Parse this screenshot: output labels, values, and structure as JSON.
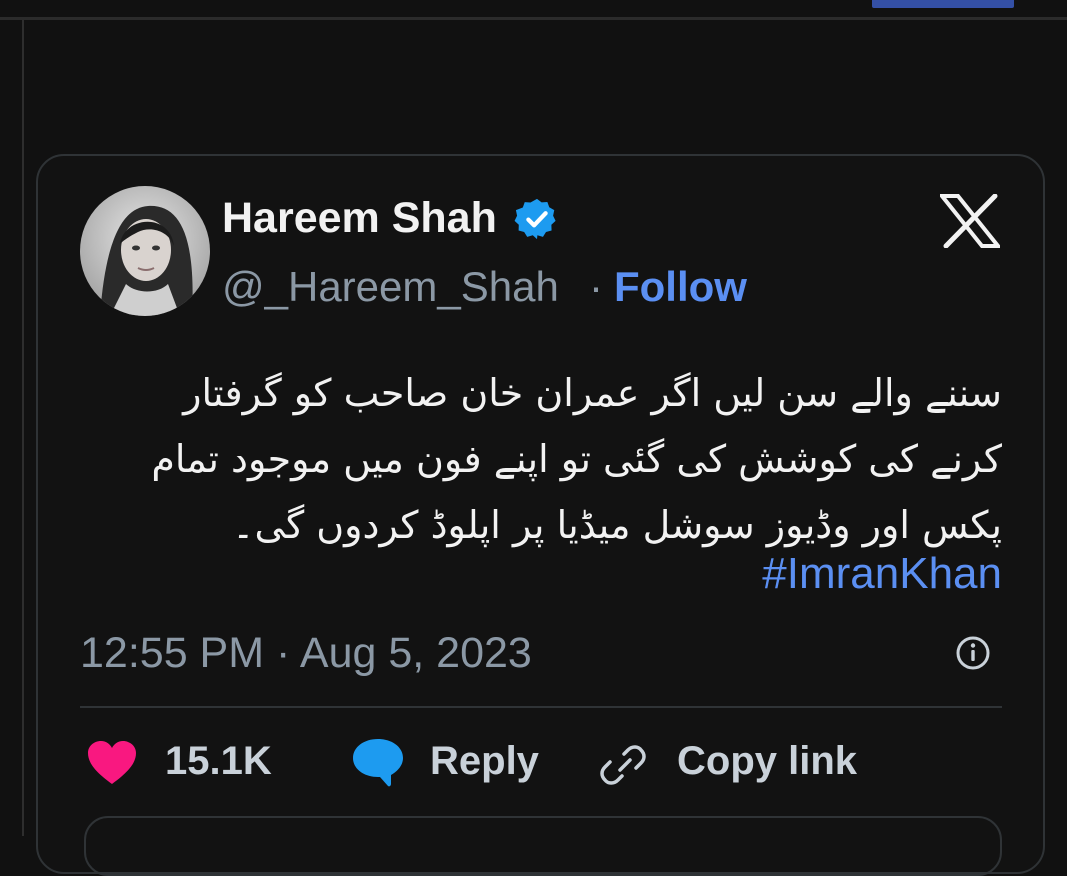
{
  "tweet": {
    "display_name": "Hareem Shah",
    "handle": "@_Hareem_Shah",
    "separator": "·",
    "follow_label": "Follow",
    "body_lines": [
      "سننے والے سن لیں اگر عمران خان صاحب کو گرفتار",
      "کرنے کی کوشش کی گئی تو اپنے فون میں موجود تمام",
      "پکس اور وڈیوز سوشل میڈیا پر اپلوڈ کردوں گی۔"
    ],
    "hashtag": "#ImranKhan",
    "timestamp": "12:55 PM · Aug 5, 2023",
    "likes": "15.1K",
    "reply_label": "Reply",
    "copy_link_label": "Copy link"
  },
  "icons": {
    "verified": "verified-badge-icon",
    "platform": "x-logo-icon",
    "info": "info-icon",
    "like": "heart-icon",
    "reply": "reply-bubble-icon",
    "link": "link-icon"
  },
  "colors": {
    "background": "#111111",
    "text": "#f2f2f2",
    "muted": "#8b98a5",
    "accent": "#5b8ff2",
    "verified": "#1d9bf0",
    "like": "#f91880",
    "reply": "#1d9bf0",
    "border": "#2f3336"
  }
}
